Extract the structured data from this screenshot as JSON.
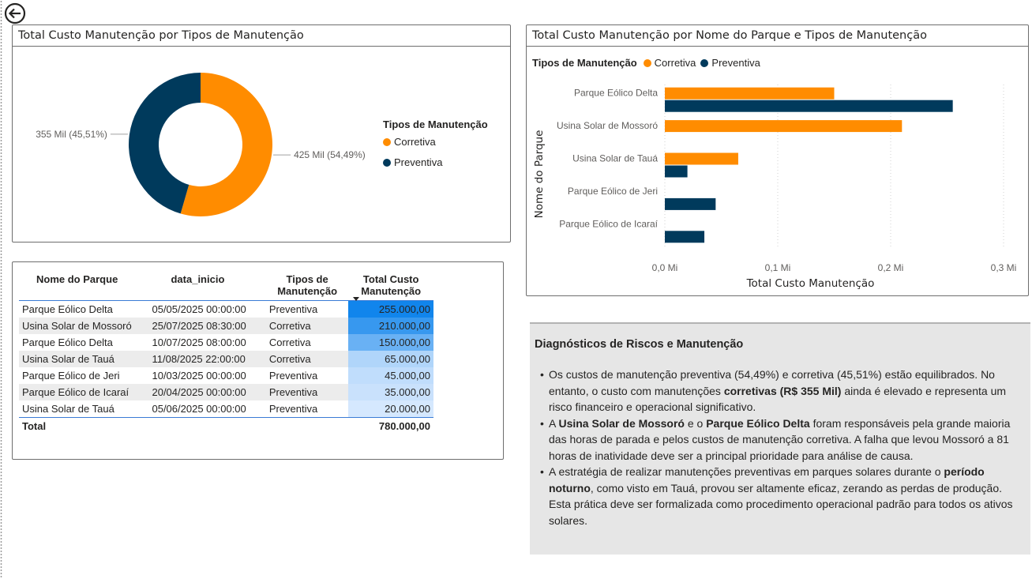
{
  "back_icon": "arrow-left-circle-icon",
  "colors": {
    "corretiva": "#FF8C00",
    "preventiva": "#003A5C",
    "accent_blue": "#3a7bd5"
  },
  "donut": {
    "title": "Total Custo Manutenção por Tipos de Manutenção",
    "legend_title": "Tipos de Manutenção",
    "legend": [
      {
        "label": "Corretiva",
        "color": "#FF8C00"
      },
      {
        "label": "Preventiva",
        "color": "#003A5C"
      }
    ],
    "label_corretiva": "425 Mil (54,49%)",
    "label_preventiva": "355 Mil (45,51%)"
  },
  "bar": {
    "title": "Total Custo Manutenção por Nome do Parque e Tipos de Manutenção",
    "legend_title": "Tipos de Manutenção",
    "legend_corretiva": "Corretiva",
    "legend_preventiva": "Preventiva"
  },
  "chart_data": [
    {
      "type": "pie",
      "title": "Total Custo Manutenção por Tipos de Manutenção",
      "categories": [
        "Corretiva",
        "Preventiva"
      ],
      "values": [
        425000,
        355000
      ],
      "legend_title": "Tipos de Manutenção",
      "legend_position": "right"
    },
    {
      "type": "bar",
      "orientation": "horizontal",
      "title": "Total Custo Manutenção por Nome do Parque e Tipos de Manutenção",
      "categories": [
        "Parque Eólico Delta",
        "Usina Solar de Mossoró",
        "Usina Solar de Tauá",
        "Parque Eólico de Jeri",
        "Parque Eólico de Icaraí"
      ],
      "series": [
        {
          "name": "Corretiva",
          "values": [
            150000,
            210000,
            65000,
            0,
            0
          ]
        },
        {
          "name": "Preventiva",
          "values": [
            255000,
            0,
            20000,
            45000,
            35000
          ]
        }
      ],
      "xlabel": "Total Custo Manutenção",
      "ylabel": "Nome do Parque",
      "xlim": [
        0,
        300000
      ],
      "xticks": [
        "0,0 Mi",
        "0,1 Mi",
        "0,2 Mi",
        "0,3 Mi"
      ],
      "grid": true,
      "legend_position": "top-left"
    }
  ],
  "table": {
    "headers": [
      "Nome do Parque",
      "data_inicio",
      "Tipos de Manutenção",
      "Total Custo Manutenção"
    ],
    "rows": [
      {
        "parque": "Parque Eólico Delta",
        "data": "05/05/2025 00:00:00",
        "tipo": "Preventiva",
        "custo": "255.000,00",
        "value": 255000
      },
      {
        "parque": "Usina Solar de Mossoró",
        "data": "25/07/2025 08:30:00",
        "tipo": "Corretiva",
        "custo": "210.000,00",
        "value": 210000
      },
      {
        "parque": "Parque Eólico Delta",
        "data": "10/07/2025 08:00:00",
        "tipo": "Corretiva",
        "custo": "150.000,00",
        "value": 150000
      },
      {
        "parque": "Usina Solar de Tauá",
        "data": "11/08/2025 22:00:00",
        "tipo": "Corretiva",
        "custo": "65.000,00",
        "value": 65000
      },
      {
        "parque": "Parque Eólico de Jeri",
        "data": "10/03/2025 00:00:00",
        "tipo": "Preventiva",
        "custo": "45.000,00",
        "value": 45000
      },
      {
        "parque": "Parque Eólico de Icaraí",
        "data": "20/04/2025 00:00:00",
        "tipo": "Preventiva",
        "custo": "35.000,00",
        "value": 35000
      },
      {
        "parque": "Usina Solar de Tauá",
        "data": "05/06/2025 00:00:00",
        "tipo": "Preventiva",
        "custo": "20.000,00",
        "value": 20000
      }
    ],
    "total_label": "Total",
    "total_value": "780.000,00"
  },
  "diag": {
    "title": "Diagnósticos de Riscos e Manutenção",
    "bullet": "•",
    "p1_a": " Os custos de manutenção preventiva (54,49%) e corretiva (45,51%) estão equilibrados. No entanto, o custo com manutenções ",
    "p1_b": "corretivas (R$ 355 Mil)",
    "p1_c": " ainda é elevado e representa um risco financeiro e operacional significativo.",
    "p2_a": "A ",
    "p2_b": "Usina Solar de Mossoró",
    "p2_c": " e o ",
    "p2_d": "Parque Eólico Delta",
    "p2_e": " foram responsáveis pela grande maioria das horas de parada e pelos custos de manutenção corretiva. A falha que levou Mossoró a 81 horas de inatividade deve ser a principal prioridade para análise de causa.",
    "p3_a": "A estratégia de realizar manutenções preventivas em parques solares durante o ",
    "p3_b": "período noturno",
    "p3_c": ", como visto em Tauá, provou ser altamente eficaz, zerando as perdas de produção. Esta prática deve ser formalizada como procedimento operacional padrão para todos os ativos solares."
  }
}
